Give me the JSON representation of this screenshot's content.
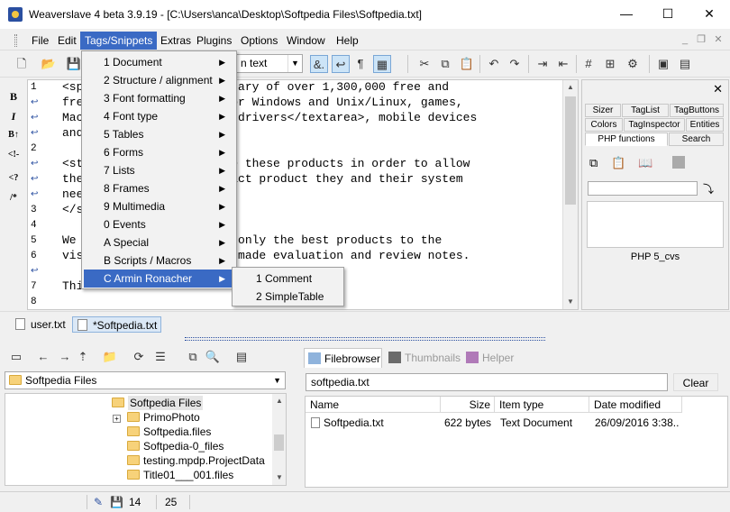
{
  "window": {
    "title": "Weaverslave 4 beta 3.9.19 - [C:\\Users\\anca\\Desktop\\Softpedia Files\\Softpedia.txt]",
    "minimize": "—",
    "maximize": "☐",
    "close": "✕"
  },
  "menubar": {
    "items": [
      "File",
      "Edit",
      "Tags/Snippets",
      "Extras",
      "Plugins",
      "Options",
      "Window",
      "Help"
    ],
    "active": "Tags/Snippets",
    "mdi_minimize": "_",
    "mdi_restore": "❐",
    "mdi_close": "✕"
  },
  "toolbar": {
    "format_combo": "n text"
  },
  "tags_menu": {
    "items": [
      "1 Document",
      "2 Structure / alignment",
      "3 Font formatting",
      "4 Font type",
      "5 Tables",
      "6 Forms",
      "7 Lists",
      "8 Frames",
      "9 Multimedia",
      "0 Events",
      "A Special",
      "B Scripts / Macros",
      "C Armin Ronacher"
    ],
    "highlighted": "C Armin Ronacher",
    "submenu": [
      "1 Comment",
      "2 SimpleTable"
    ]
  },
  "editor": {
    "line_numbers": [
      "1",
      "",
      "",
      "",
      "2",
      "",
      "",
      "",
      "3",
      "4",
      "5",
      "6",
      "",
      "7",
      "8",
      "9"
    ],
    "lines": [
      "<sp              s a library of over 1,300,000 free and",
      "fre              grams for Windows and Unix/Linux, games,",
      "Mac              Windows drivers</textarea>, mobile devices",
      "and",
      "",
      "<st              tegorize these products in order to allow",
      "the               the exact product they and their system",
      "nee",
      "</s",
      "",
      "We               r</del> only the best products to the",
      "vis              ch self-made evaluation and review notes.",
      "",
      "Thi",
      "",
      ""
    ]
  },
  "left_tools": [
    "B",
    "I",
    "B↑",
    "<!-",
    "<?",
    "/*"
  ],
  "right_panel": {
    "close": "✕",
    "tabs_row1": [
      "Sizer",
      "TagList",
      "TagButtons"
    ],
    "tabs_row2": [
      "Colors",
      "TagInspector",
      "Entities"
    ],
    "tabs_row3": [
      "PHP functions",
      "Search"
    ],
    "label": "PHP 5_cvs"
  },
  "doc_tabs": [
    "user.txt",
    "*Softpedia.txt"
  ],
  "file_browser": {
    "path": "Softpedia Files",
    "tree": [
      {
        "label": "Softpedia Files",
        "kind": "folder-open",
        "depth": 0
      },
      {
        "label": "PrimoPhoto",
        "kind": "folder",
        "depth": 1
      },
      {
        "label": "Softpedia.files",
        "kind": "folder",
        "depth": 1
      },
      {
        "label": "Softpedia-0_files",
        "kind": "folder",
        "depth": 1
      },
      {
        "label": "testing.mpdp.ProjectData",
        "kind": "folder",
        "depth": 1
      },
      {
        "label": "Title01___001.files",
        "kind": "folder",
        "depth": 1
      }
    ],
    "tabs": [
      "Filebrowser",
      "Thumbnails",
      "Helper"
    ],
    "search_value": "softpedia.txt",
    "clear_label": "Clear",
    "columns": [
      "Name",
      "Size",
      "Item type",
      "Date modified"
    ],
    "rows": [
      {
        "name": "Softpedia.txt",
        "size": "622 bytes",
        "type": "Text Document",
        "date": "26/09/2016 3:38..."
      }
    ]
  },
  "status": {
    "line": "14",
    "col": "25"
  },
  "colors": {
    "accent": "#3a6ac4",
    "selected_tab": "#dbe8f6"
  }
}
